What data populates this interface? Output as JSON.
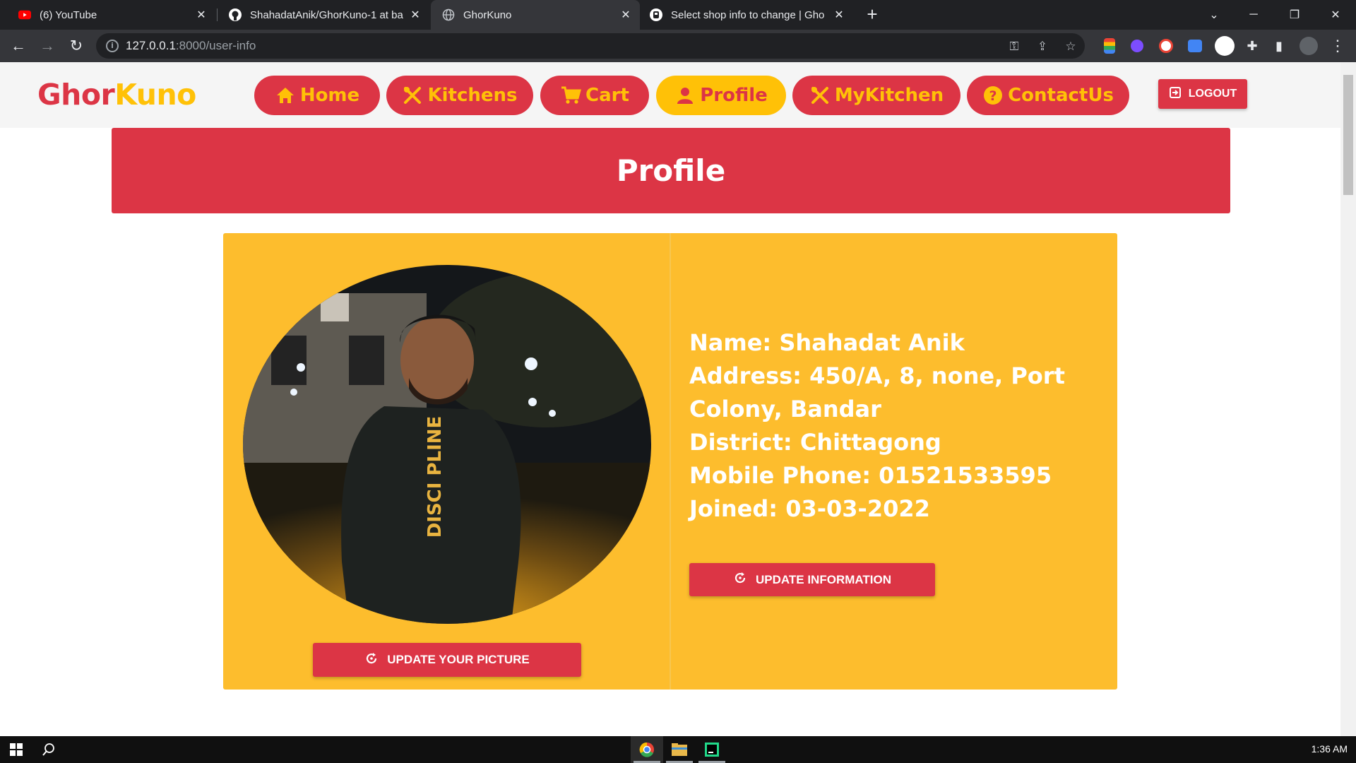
{
  "browser": {
    "tabs": [
      {
        "title": "(6) YouTube",
        "icon": "youtube-icon",
        "active": false
      },
      {
        "title": "ShahadatAnik/GhorKuno-1 at ba",
        "icon": "github-icon",
        "active": false
      },
      {
        "title": "GhorKuno",
        "icon": "globe-icon",
        "active": true
      },
      {
        "title": "Select shop info to change | Gho",
        "icon": "django-admin-icon",
        "active": false
      }
    ],
    "url_host": "127.0.0.1",
    "url_rest": ":8000/user-info"
  },
  "site": {
    "logo_part1": "Ghor",
    "logo_part2": "Kuno",
    "nav": [
      {
        "label": "Home",
        "icon": "home-icon"
      },
      {
        "label": "Kitchens",
        "icon": "utensils-icon"
      },
      {
        "label": "Cart",
        "icon": "cart-icon"
      },
      {
        "label": "Profile",
        "icon": "user-icon"
      },
      {
        "label": "MyKitchen",
        "icon": "utensils-icon"
      },
      {
        "label": "ContactUs",
        "icon": "question-circle-icon"
      }
    ],
    "active_nav": "Profile",
    "logout_label": "LOGOUT"
  },
  "profile": {
    "banner_title": "Profile",
    "name_line": "Name: Shahadat Anik",
    "address_line": "Address: 450/A, 8, none, Port Colony, Bandar",
    "district_line": "District: Chittagong",
    "phone_line": "Mobile Phone: 01521533595",
    "joined_line": "Joined: 03-03-2022",
    "update_info_label": "UPDATE INFORMATION",
    "update_picture_label": "UPDATE YOUR PICTURE",
    "photo_shirt_text": "DISCI PLINE"
  },
  "taskbar": {
    "clock": "1:36 AM"
  },
  "colors": {
    "brand_red": "#dc3545",
    "brand_yellow": "#ffc107",
    "card_yellow": "#fdbd2d"
  }
}
